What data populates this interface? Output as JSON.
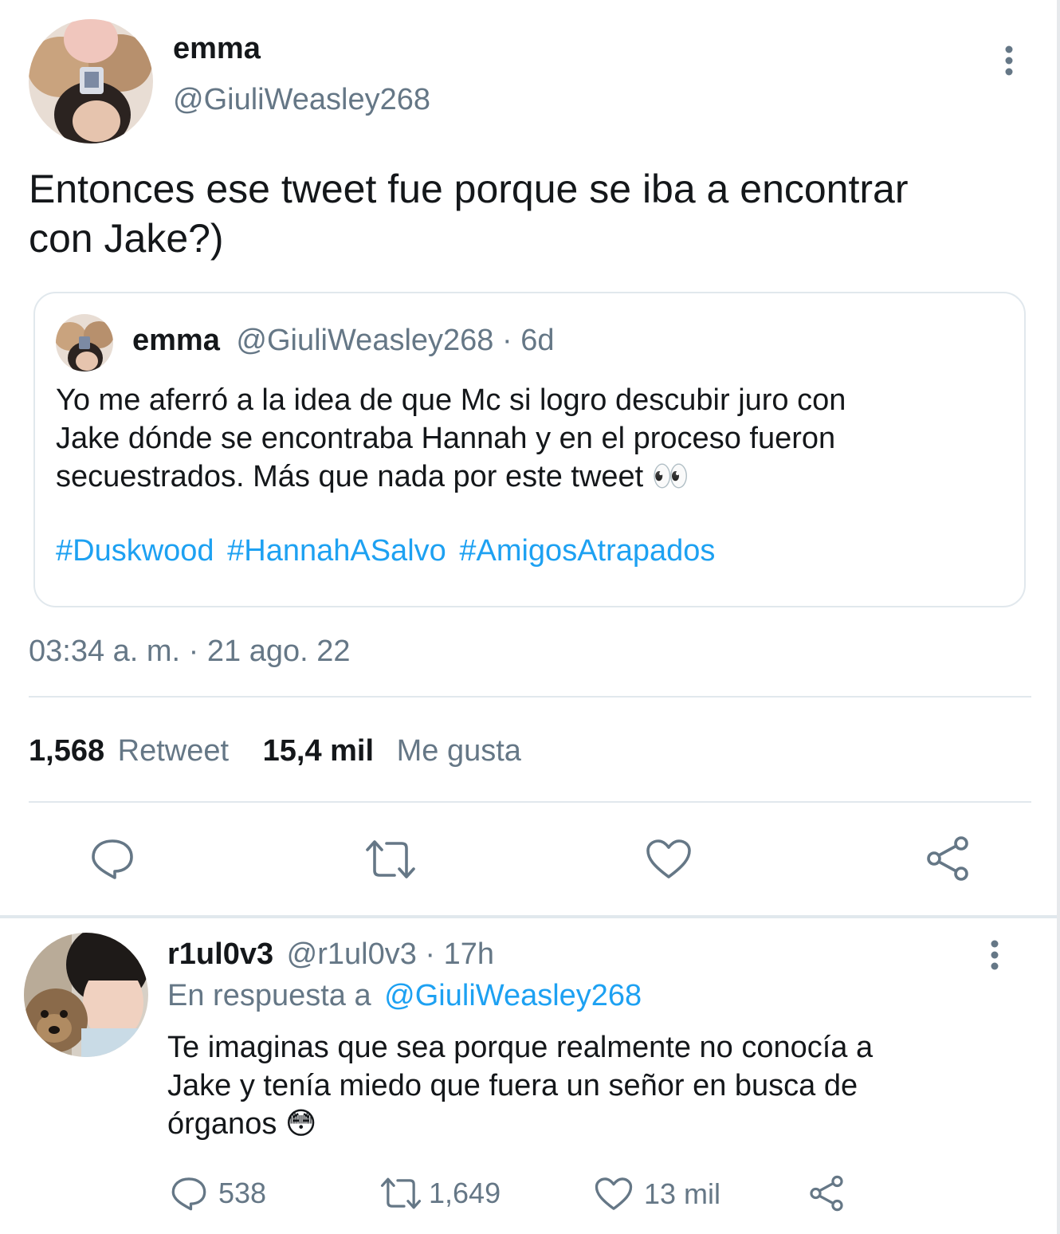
{
  "main_tweet": {
    "display_name": "emma",
    "handle": "@GiuliWeasley268",
    "text_line1": "Entonces ese tweet fue porque se iba a encontrar",
    "text_line2": "con Jake?)",
    "timestamp": "03:34 a. m. · 21 ago. 22",
    "stats": {
      "retweets_count": "1,568",
      "retweets_label": "Retweet",
      "likes_count": "15,4 mil",
      "likes_label": "Me gusta"
    },
    "quoted": {
      "display_name": "emma",
      "handle_time": "@GiuliWeasley268 · 6d",
      "line1": "Yo me aferró a la idea de que Mc si logro descubir juro con",
      "line2": "Jake dónde se encontraba Hannah y en el proceso fueron",
      "line3": "secuestrados. Más que nada por este tweet 👀",
      "hashtags": [
        "#Duskwood",
        "#HannahASalvo",
        "#AmigosAtrapados"
      ]
    },
    "actions": [
      "reply-icon",
      "retweet-icon",
      "like-icon",
      "share-icon"
    ]
  },
  "reply_tweet": {
    "display_name": "r1ul0v3",
    "handle_time": "@r1ul0v3 · 17h",
    "reply_prefix": "En respuesta a",
    "reply_to": "@GiuliWeasley268",
    "line1": "Te imaginas que sea porque realmente no conocía a",
    "line2": "Jake y tenía miedo que fuera un señor en busca de",
    "line3": "órganos 😳",
    "counts": {
      "replies": "538",
      "retweets": "1,649",
      "likes": "13 mil"
    }
  },
  "colors": {
    "text": "#14171a",
    "secondary": "#657786",
    "link": "#1da1f2",
    "divider": "#e1e8ed"
  }
}
